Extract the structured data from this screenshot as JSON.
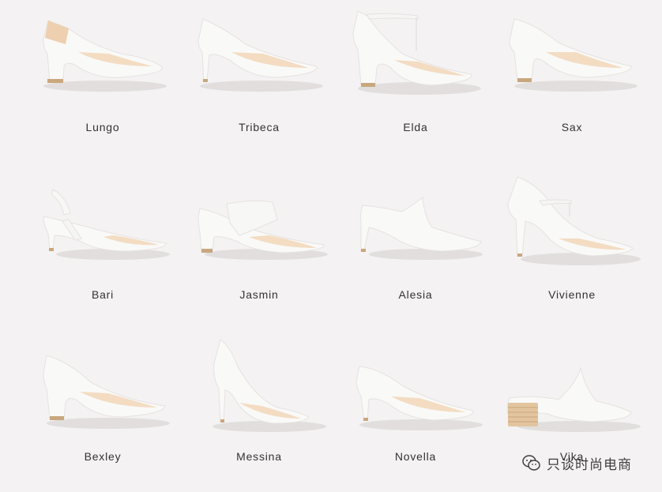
{
  "colors": {
    "background": "#f4f2f2",
    "leather": "#f9f9f8",
    "lining": "#f3dcc2",
    "heel_tip": "#c9a77e",
    "shadow": "#d9d5d4",
    "label": "#333333",
    "nude_accent": "#eecfb0",
    "wood_heel": "#e2c59f"
  },
  "catalog": {
    "shoes": [
      {
        "name": "Lungo",
        "icon": "pump-heel-strap-icon"
      },
      {
        "name": "Tribeca",
        "icon": "stiletto-pump-icon"
      },
      {
        "name": "Elda",
        "icon": "ankle-strap-pump-icon"
      },
      {
        "name": "Sax",
        "icon": "block-heel-pump-icon"
      },
      {
        "name": "Bari",
        "icon": "slingback-icon"
      },
      {
        "name": "Jasmin",
        "icon": "mule-sandal-icon"
      },
      {
        "name": "Alesia",
        "icon": "pointed-mule-icon"
      },
      {
        "name": "Vivienne",
        "icon": "ankle-strap-stiletto-icon"
      },
      {
        "name": "Bexley",
        "icon": "block-heel-pump-icon"
      },
      {
        "name": "Messina",
        "icon": "high-stiletto-pump-icon"
      },
      {
        "name": "Novella",
        "icon": "mid-heel-pump-icon"
      },
      {
        "name": "Vika",
        "icon": "wood-heel-mule-icon"
      }
    ]
  },
  "watermark": {
    "text": "只谈时尚电商",
    "icon": "wechat-icon"
  }
}
